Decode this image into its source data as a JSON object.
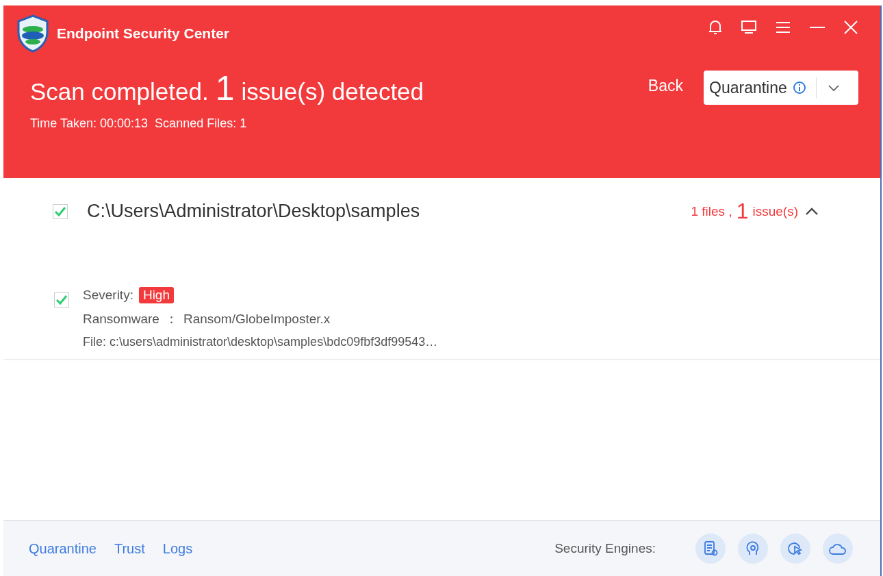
{
  "window": {
    "title": "Endpoint Security Center"
  },
  "summary": {
    "prefix": "Scan completed.",
    "count": "1",
    "suffix": "issue(s) detected",
    "stats": "Time Taken: 00:00:13  Scanned Files: 1"
  },
  "back": "Back",
  "action_select": {
    "value": "Quarantine"
  },
  "group": {
    "path": "C:\\Users\\Administrator\\Desktop\\samples",
    "checked": true,
    "expanded": true,
    "files": "1 files ,",
    "count": "1",
    "issues": "issue(s)",
    "items": [
      {
        "checked": true,
        "severity_label": "Severity:",
        "severity": "High",
        "type": "Ransomware",
        "separator": "：",
        "threat": "Ransom/GlobeImposter.x",
        "file": "File: c:\\users\\administrator\\desktop\\samples\\bdc09fbf3df99543…"
      }
    ]
  },
  "footer": {
    "links": [
      "Quarantine",
      "Trust",
      "Logs"
    ],
    "engines_label": "Security Engines:"
  }
}
